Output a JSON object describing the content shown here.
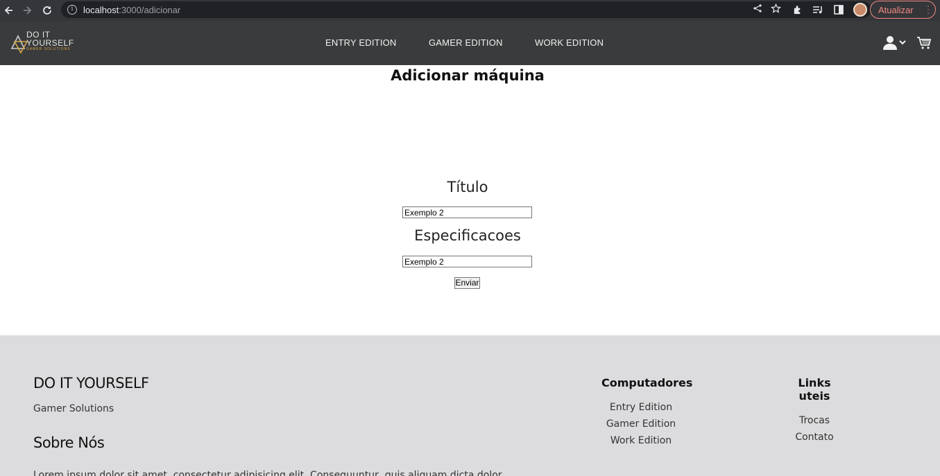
{
  "browser": {
    "url_host": "localhost",
    "url_path": ":3000/adicionar",
    "update_label": "Atualizar",
    "icons": [
      "back-icon",
      "forward-icon",
      "reload-icon",
      "info-icon",
      "share-icon",
      "star-icon",
      "extensions-icon",
      "media-icon",
      "sidepanel-icon",
      "profile-avatar",
      "kebab-icon"
    ]
  },
  "header": {
    "logo_line1": "DO IT",
    "logo_line2": "YOURSELF",
    "logo_line3": "GAMER SOLUTIONS",
    "nav": [
      "ENTRY EDITION",
      "GAMER EDITION",
      "WORK EDITION"
    ]
  },
  "main": {
    "title": "Adicionar máquina",
    "fields": [
      {
        "label": "Título",
        "value": "Exemplo 2"
      },
      {
        "label": "Especificacoes",
        "value": "Exemplo 2"
      }
    ],
    "submit_label": "Enviar"
  },
  "footer": {
    "brand": "DO IT YOURSELF",
    "tagline": "Gamer Solutions",
    "about_title": "Sobre Nós",
    "about_text": "Lorem ipsum dolor sit amet, consectetur adipisicing elit. Consequuntur, quis aliquam dicta dolor",
    "columns": [
      {
        "title": "Computadores",
        "links": [
          "Entry Edition",
          "Gamer Edition",
          "Work Edition"
        ]
      },
      {
        "title": "Links uteis",
        "links": [
          "Trocas",
          "Contato"
        ]
      }
    ]
  },
  "colors": {
    "browser_bg": "#35363a",
    "header_bg": "#3a3b3c",
    "footer_bg": "#dcdcde",
    "logo_accent": "#d4a84a",
    "update_accent": "#f28b82"
  }
}
